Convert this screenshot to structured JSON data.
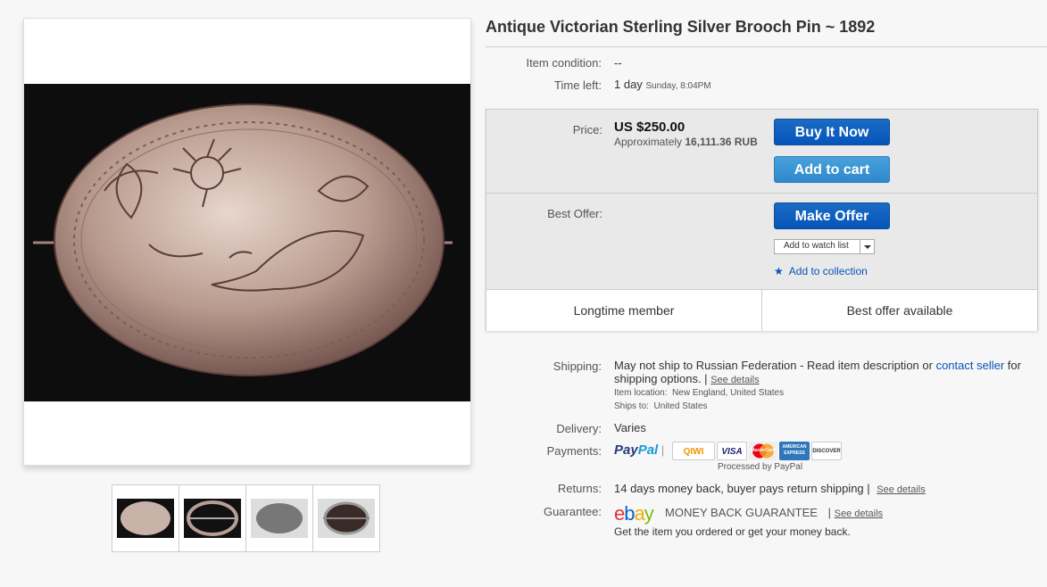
{
  "title": "Antique Victorian Sterling Silver Brooch Pin ~ 1892",
  "condition": {
    "label": "Item condition:",
    "value": "--"
  },
  "time_left": {
    "label": "Time left:",
    "value": "1 day",
    "detail": "Sunday, 8:04PM"
  },
  "price": {
    "label": "Price:",
    "value": "US $250.00",
    "approx_prefix": "Approximately",
    "approx_value": "16,111.36 RUB"
  },
  "buttons": {
    "buy_now": "Buy It Now",
    "add_to_cart": "Add to cart",
    "make_offer": "Make Offer",
    "watch_list": "Add to watch list",
    "add_collection": "Add to collection"
  },
  "best_offer": {
    "label": "Best Offer:"
  },
  "strip": {
    "left": "Longtime member",
    "right": "Best offer available"
  },
  "shipping": {
    "label": "Shipping:",
    "text1": "May not ship to Russian Federation - Read item description or",
    "contact": "contact seller",
    "text2": "for",
    "text3": "shipping options. |",
    "see": "See details",
    "location_label": "Item location:",
    "location": "New England, United States",
    "ships_label": "Ships to:",
    "ships": "United States"
  },
  "delivery": {
    "label": "Delivery:",
    "value": "Varies"
  },
  "payments": {
    "label": "Payments:",
    "paypal_a": "Pay",
    "paypal_b": "Pal",
    "sep": "|",
    "cards": [
      "QIWI",
      "VISA",
      "MasterCard",
      "AMERICAN EXPRESS",
      "DISCOVER"
    ],
    "processed": "Processed by PayPal"
  },
  "returns": {
    "label": "Returns:",
    "value": "14 days money back, buyer pays return shipping |",
    "see": "See details"
  },
  "guarantee": {
    "label": "Guarantee:",
    "logo_e": "e",
    "logo_b": "b",
    "logo_a": "a",
    "logo_y": "y",
    "mbg": "MONEY BACK GUARANTEE",
    "sep": "|",
    "see": "See details",
    "note": "Get the item you ordered or get your money back."
  }
}
